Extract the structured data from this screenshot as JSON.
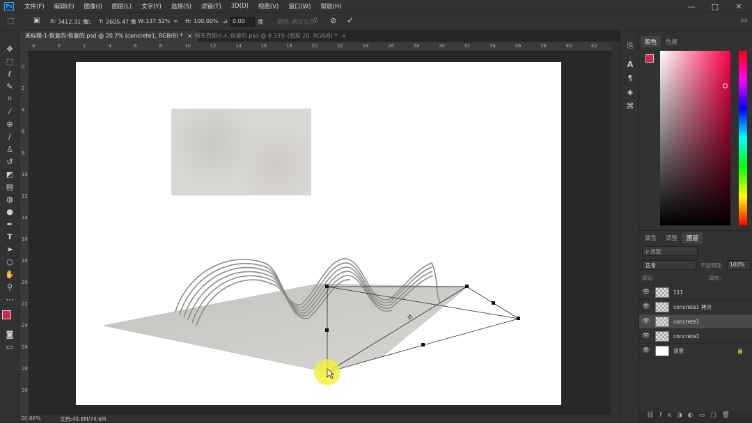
{
  "menubar": {
    "items": [
      "文件(F)",
      "编辑(E)",
      "图像(I)",
      "图层(L)",
      "文字(Y)",
      "选择(S)",
      "滤镜(T)",
      "3D(D)",
      "视图(V)",
      "窗口(W)",
      "帮助(H)"
    ],
    "logo": "Ps",
    "window_controls": [
      "—",
      "□",
      "✕"
    ]
  },
  "options": {
    "x_label": "X:",
    "x_value": "3412.31 像",
    "y_label": "Y:",
    "y_value": "2605.47 像",
    "w_label": "W:",
    "w_value": "137.52%",
    "h_label": "H:",
    "h_value": "100.00%",
    "angle_value": "0.00",
    "angle_unit": "度",
    "interp": "插值: 两次立方"
  },
  "tabs": [
    {
      "label": "未标题-1-恢复的-恢复的.psd @ 20.7% (concrete1, RGB/8) *",
      "close": "×"
    },
    {
      "label": "柯布西耶小人-恢复的.psd @ 8.33% (图层 20, RGB/8) *",
      "close": "×"
    }
  ],
  "ruler_h": [
    "4",
    "0",
    "2",
    "4",
    "6",
    "8",
    "10",
    "12",
    "14",
    "16",
    "18",
    "20",
    "22",
    "24",
    "26",
    "28",
    "30",
    "32",
    "34",
    "36",
    "38",
    "40",
    "42"
  ],
  "ruler_v": [
    "0",
    "2",
    "4",
    "6",
    "8",
    "10",
    "12",
    "14",
    "16",
    "18",
    "20",
    "22",
    "24",
    "26",
    "28",
    "30"
  ],
  "status": {
    "zoom": "20.66%",
    "doc": "文档:49.8M/74.6M"
  },
  "color_panel": {
    "tabs": [
      "颜色",
      "色板"
    ],
    "fg": "#d4244a",
    "bg": "#000000"
  },
  "layers_panel": {
    "tabs": [
      "属性",
      "调整",
      "图层"
    ],
    "kind": "ρ 类型",
    "blend": "正常",
    "opacity_label": "不透明度:",
    "opacity": "100%",
    "lock_label": "锁定:",
    "fill_label": "填充:",
    "layers": [
      {
        "name": "111",
        "eye": "👁"
      },
      {
        "name": "concrete1 拷贝",
        "eye": "👁"
      },
      {
        "name": "concrete1",
        "eye": "👁"
      },
      {
        "name": "concrete1",
        "eye": "👁"
      },
      {
        "name": "背景",
        "eye": "👁",
        "lock": "🔒"
      }
    ]
  }
}
